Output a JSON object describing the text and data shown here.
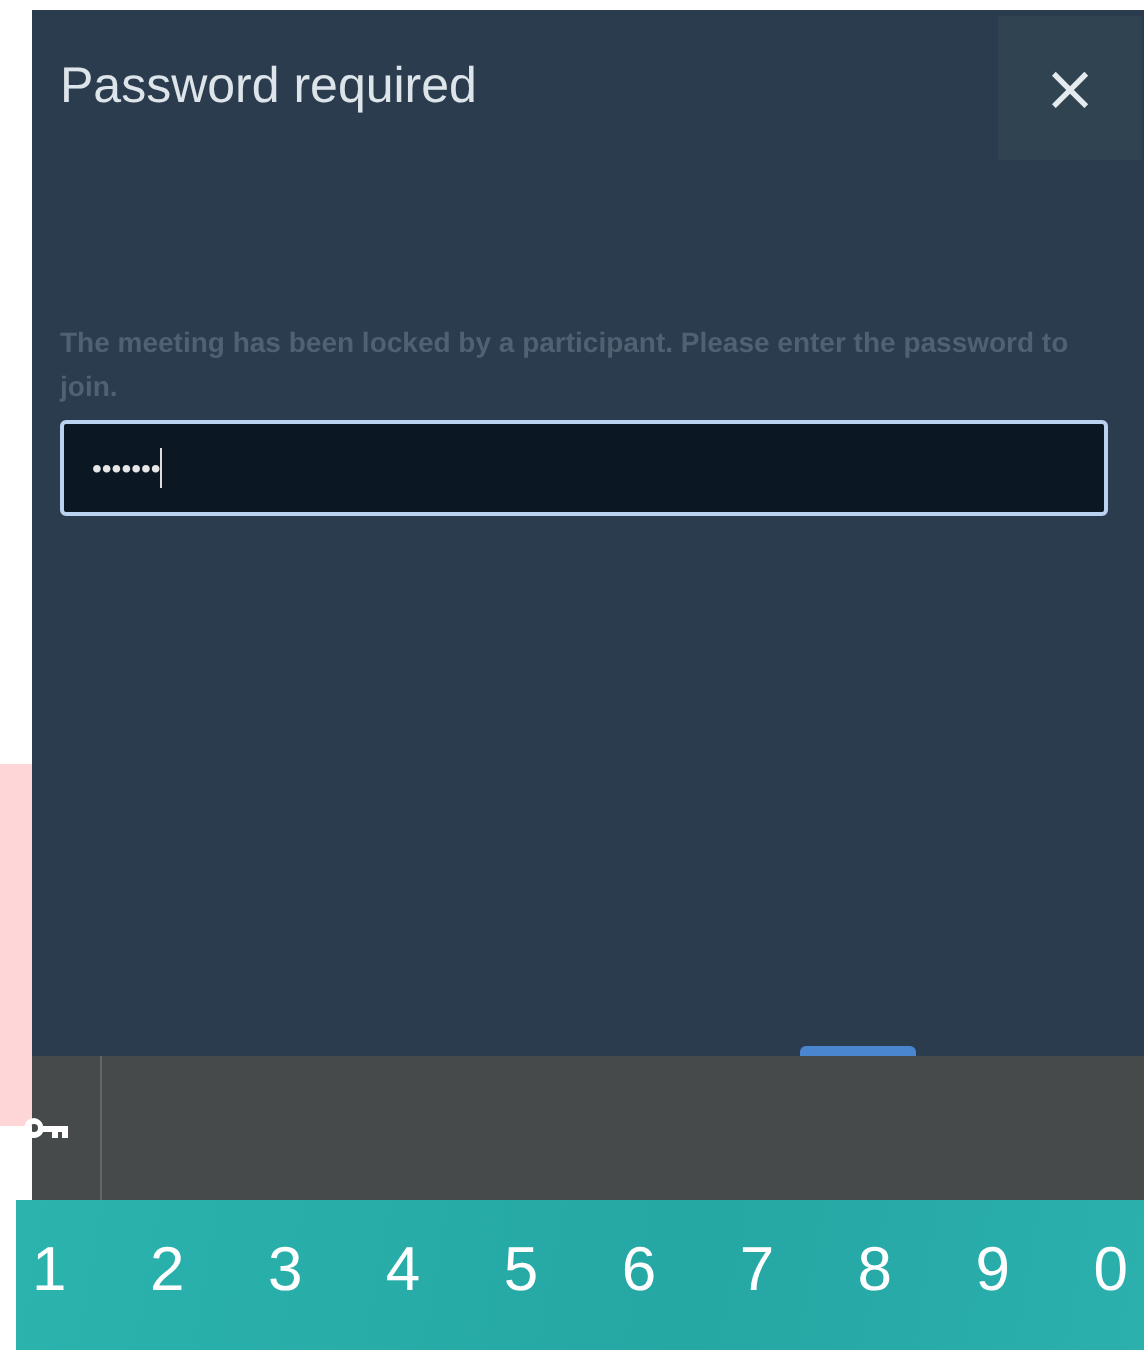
{
  "dialog": {
    "title": "Password required",
    "close_label": "×",
    "message": "The meeting has been locked by a participant. Please enter the password to join.",
    "password_field": {
      "value": "•••••••",
      "focused": true
    }
  },
  "keyboard": {
    "number_keys": [
      "1",
      "2",
      "3",
      "4",
      "5",
      "6",
      "7",
      "8",
      "9",
      "0"
    ]
  }
}
